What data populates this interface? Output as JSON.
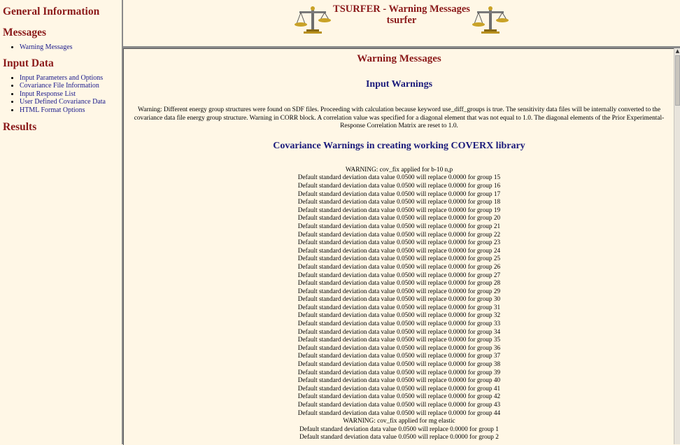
{
  "sidebar": {
    "general_information": "General Information",
    "messages_heading": "Messages",
    "messages_items": [
      "Warning Messages"
    ],
    "input_data_heading": "Input Data",
    "input_data_items": [
      "Input Parameters and Options",
      "Covariance File Information",
      "Input Response List",
      "User Defined Covariance Data",
      "HTML Format Options"
    ],
    "results_heading": "Results"
  },
  "header": {
    "title": "TSURFER - Warning Messages",
    "subtitle": "tsurfer",
    "logo_icon": "scales-of-justice-icon"
  },
  "main": {
    "page_title": "Warning Messages",
    "input_warnings_title": "Input Warnings",
    "input_warning_text": "Warning: Different energy group structures were found on SDF files. Proceeding with calculation because keyword use_diff_groups is true. The sensitivity data files will be internally converted to the covariance data file energy group structure. Warning in CORR block. A correlation value was specified for a diagonal element that was not equal to 1.0. The diagonal elements of the Prior Experimental-Response Correlation Matrix are reset to 1.0.",
    "covariance_warnings_title": "Covariance Warnings in creating working COVERX library",
    "warning_lines": [
      "WARNING: cov_fix applied for b-10 n,p",
      "Default standard deviation data value 0.0500 will replace 0.0000 for group 15",
      "Default standard deviation data value 0.0500 will replace 0.0000 for group 16",
      "Default standard deviation data value 0.0500 will replace 0.0000 for group 17",
      "Default standard deviation data value 0.0500 will replace 0.0000 for group 18",
      "Default standard deviation data value 0.0500 will replace 0.0000 for group 19",
      "Default standard deviation data value 0.0500 will replace 0.0000 for group 20",
      "Default standard deviation data value 0.0500 will replace 0.0000 for group 21",
      "Default standard deviation data value 0.0500 will replace 0.0000 for group 22",
      "Default standard deviation data value 0.0500 will replace 0.0000 for group 23",
      "Default standard deviation data value 0.0500 will replace 0.0000 for group 24",
      "Default standard deviation data value 0.0500 will replace 0.0000 for group 25",
      "Default standard deviation data value 0.0500 will replace 0.0000 for group 26",
      "Default standard deviation data value 0.0500 will replace 0.0000 for group 27",
      "Default standard deviation data value 0.0500 will replace 0.0000 for group 28",
      "Default standard deviation data value 0.0500 will replace 0.0000 for group 29",
      "Default standard deviation data value 0.0500 will replace 0.0000 for group 30",
      "Default standard deviation data value 0.0500 will replace 0.0000 for group 31",
      "Default standard deviation data value 0.0500 will replace 0.0000 for group 32",
      "Default standard deviation data value 0.0500 will replace 0.0000 for group 33",
      "Default standard deviation data value 0.0500 will replace 0.0000 for group 34",
      "Default standard deviation data value 0.0500 will replace 0.0000 for group 35",
      "Default standard deviation data value 0.0500 will replace 0.0000 for group 36",
      "Default standard deviation data value 0.0500 will replace 0.0000 for group 37",
      "Default standard deviation data value 0.0500 will replace 0.0000 for group 38",
      "Default standard deviation data value 0.0500 will replace 0.0000 for group 39",
      "Default standard deviation data value 0.0500 will replace 0.0000 for group 40",
      "Default standard deviation data value 0.0500 will replace 0.0000 for group 41",
      "Default standard deviation data value 0.0500 will replace 0.0000 for group 42",
      "Default standard deviation data value 0.0500 will replace 0.0000 for group 43",
      "Default standard deviation data value 0.0500 will replace 0.0000 for group 44",
      "WARNING: cov_fix applied for mg elastic",
      "Default standard deviation data value 0.0500 will replace 0.0000 for group 1",
      "Default standard deviation data value 0.0500 will replace 0.0000 for group 2"
    ]
  },
  "colors": {
    "background": "#fff7e6",
    "heading_red": "#8b1a1a",
    "heading_blue": "#1a1a7a",
    "link_blue": "#1a1a8b"
  }
}
